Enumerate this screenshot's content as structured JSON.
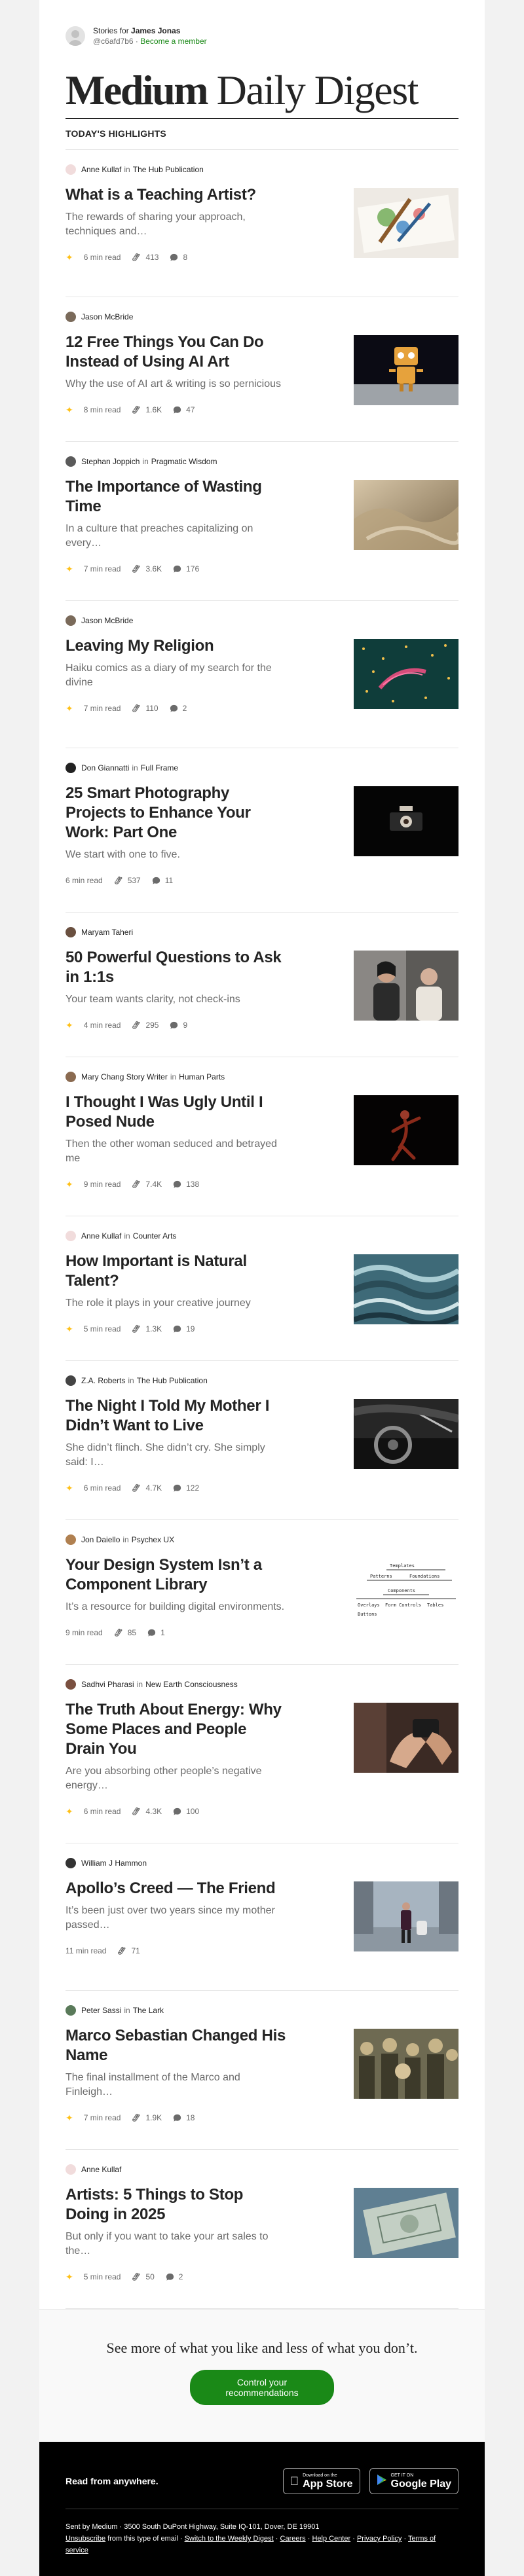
{
  "header": {
    "stories_for_prefix": "Stories for",
    "user_name": "James Jonas",
    "handle": "@c6afd7b6",
    "separator": "·",
    "become_member": "Become a member",
    "brand": "Medium",
    "digest": "Daily Digest",
    "section_label": "TODAY'S HIGHLIGHTS"
  },
  "labels": {
    "in": "in"
  },
  "articles": [
    {
      "author": "Anne Kullaf",
      "publication": "The Hub Publication",
      "title": "What is a Teaching Artist?",
      "subtitle": "The rewards of sharing your approach, techniques and…",
      "read_time": "6 min read",
      "claps": "413",
      "responses": "8",
      "member_only": true,
      "avatar_color": "#f1dcdc",
      "thumb": "brushes-icon"
    },
    {
      "author": "Jason McBride",
      "publication": "",
      "title": "12 Free Things You Can Do Instead of Using AI Art",
      "subtitle": "Why the use of AI art & writing is so pernicious",
      "read_time": "8 min read",
      "claps": "1.6K",
      "responses": "47",
      "member_only": true,
      "avatar_color": "#7a6a5a",
      "thumb": "robot-icon"
    },
    {
      "author": "Stephan Joppich",
      "publication": "Pragmatic Wisdom",
      "title": "The Importance of Wasting Time",
      "subtitle": "In a culture that preaches capitalizing on every…",
      "read_time": "7 min read",
      "claps": "3.6K",
      "responses": "176",
      "member_only": true,
      "avatar_color": "#5a5a5a",
      "thumb": "fabric-icon"
    },
    {
      "author": "Jason McBride",
      "publication": "",
      "title": "Leaving My Religion",
      "subtitle": "Haiku comics as a diary of my search for the divine",
      "read_time": "7 min read",
      "claps": "110",
      "responses": "2",
      "member_only": true,
      "avatar_color": "#7a6a5a",
      "thumb": "stars-icon"
    },
    {
      "author": "Don Giannatti",
      "publication": "Full Frame",
      "title": "25 Smart Photography Projects to Enhance Your Work: Part One",
      "subtitle": "We start with one to five.",
      "read_time": "6 min read",
      "claps": "537",
      "responses": "11",
      "member_only": false,
      "avatar_color": "#222222",
      "thumb": "dark-photo-icon"
    },
    {
      "author": "Maryam Taheri",
      "publication": "",
      "title": "50 Powerful Questions to Ask in 1:1s",
      "subtitle": "Your team wants clarity, not check-ins",
      "read_time": "4 min read",
      "claps": "295",
      "responses": "9",
      "member_only": true,
      "avatar_color": "#6a5040",
      "thumb": "meeting-icon"
    },
    {
      "author": "Mary Chang Story Writer",
      "publication": "Human Parts",
      "title": "I Thought I Was Ugly Until I Posed Nude",
      "subtitle": "Then the other woman seduced and betrayed me",
      "read_time": "9 min read",
      "claps": "7.4K",
      "responses": "138",
      "member_only": true,
      "avatar_color": "#8a6a50",
      "thumb": "dancer-icon"
    },
    {
      "author": "Anne Kullaf",
      "publication": "Counter Arts",
      "title": "How Important is Natural Talent?",
      "subtitle": "The role it plays in your creative journey",
      "read_time": "5 min read",
      "claps": "1.3K",
      "responses": "19",
      "member_only": true,
      "avatar_color": "#f1dcdc",
      "thumb": "waves-icon"
    },
    {
      "author": "Z.A. Roberts",
      "publication": "The Hub Publication",
      "title": "The Night I Told My Mother I Didn’t Want to Live",
      "subtitle": "She didn’t flinch. She didn’t cry. She simply said: I…",
      "read_time": "6 min read",
      "claps": "4.7K",
      "responses": "122",
      "member_only": true,
      "avatar_color": "#444444",
      "thumb": "car-icon"
    },
    {
      "author": "Jon Daiello",
      "publication": "Psychex UX",
      "title": "Your Design System Isn’t a Component Library",
      "subtitle": "It’s a resource for building digital environments.",
      "read_time": "9 min read",
      "claps": "85",
      "responses": "1",
      "member_only": false,
      "avatar_color": "#b08050",
      "thumb": "sketch-icon",
      "sketch": {
        "top": "Templates",
        "mid_left": "Patterns",
        "mid_right": "Foundations",
        "row2": "Components",
        "b1": "Overlays",
        "b2": "Form Controls",
        "b3": "Tables",
        "b4": "Buttons"
      }
    },
    {
      "author": "Sadhvi Pharasi",
      "publication": "New Earth Consciousness",
      "title": "The Truth About Energy: Why Some Places and People Drain You",
      "subtitle": "Are you absorbing other people’s negative energy…",
      "read_time": "6 min read",
      "claps": "4.3K",
      "responses": "100",
      "member_only": true,
      "avatar_color": "#7a5040",
      "thumb": "hands-icon"
    },
    {
      "author": "William J Hammon",
      "publication": "",
      "title": "Apollo’s Creed — The Friend",
      "subtitle": "It’s been just over two years since my mother passed…",
      "read_time": "11 min read",
      "claps": "71",
      "responses": "",
      "member_only": false,
      "avatar_color": "#333333",
      "thumb": "walker-icon"
    },
    {
      "author": "Peter Sassi",
      "publication": "The Lark",
      "title": "Marco Sebastian Changed His Name",
      "subtitle": "The final installment of the Marco and Finleigh…",
      "read_time": "7 min read",
      "claps": "1.9K",
      "responses": "18",
      "member_only": true,
      "avatar_color": "#5a7a5a",
      "thumb": "crowd-icon"
    },
    {
      "author": "Anne Kullaf",
      "publication": "",
      "title": "Artists: 5 Things to Stop Doing in 2025",
      "subtitle": "But only if you want to take your art sales to the…",
      "read_time": "5 min read",
      "claps": "50",
      "responses": "2",
      "member_only": true,
      "avatar_color": "#f1dcdc",
      "thumb": "money-icon"
    }
  ],
  "cta": {
    "line": "See more of what you like and less of what you don’t.",
    "button": "Control your recommendations"
  },
  "footer": {
    "tagline": "Read from anywhere.",
    "app_store_small": "Download on the",
    "app_store_big": "App Store",
    "google_small": "GET IT ON",
    "google_big": "Google Play",
    "sent_by": "Sent by Medium · 3500 South DuPont Highway, Suite IQ-101, Dover, DE 19901",
    "unsubscribe": "Unsubscribe",
    "from_type": "from this type of email ·",
    "switch_weekly": "Switch to the Weekly Digest",
    "careers": "Careers",
    "help_center": "Help Center",
    "privacy_policy": "Privacy Policy",
    "terms": "Terms of service",
    "dot": "·"
  }
}
